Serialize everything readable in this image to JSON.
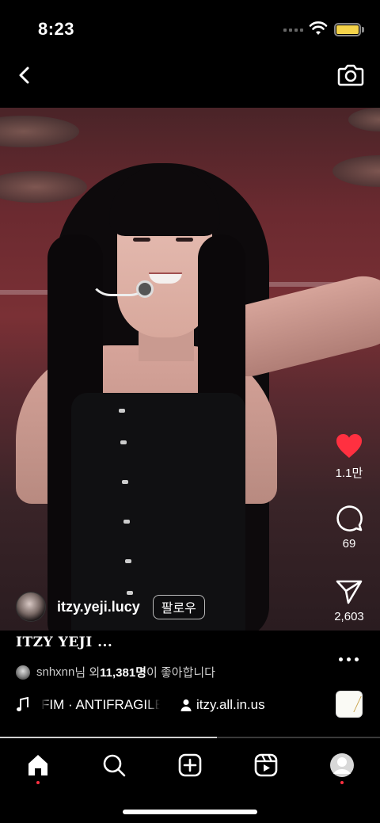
{
  "status_bar": {
    "time": "8:23",
    "battery_color": "#f5d34a"
  },
  "top_bar": {
    "back_icon": "chevron-left-icon",
    "camera_icon": "camera-icon"
  },
  "actions": {
    "like": {
      "icon": "heart-icon",
      "count": "1.1만",
      "liked": true,
      "color": "#ff3040"
    },
    "comment": {
      "icon": "comment-icon",
      "count": "69"
    },
    "share": {
      "icon": "send-icon",
      "count": "2,603"
    }
  },
  "author": {
    "username": "itzy.yeji.lucy",
    "follow_label": "팔로우"
  },
  "caption": {
    "text": "ITZY YEJI ..."
  },
  "likes": {
    "user": "snhxnn",
    "suffix_1": "님 외 ",
    "count": "11,381명",
    "suffix_2": "이 좋아합니다"
  },
  "audio": {
    "track": "FIM · ANTIFRAGILE",
    "audio_user": "itzy.all.in.us"
  },
  "playback": {
    "progress": 0.57
  },
  "bottom_nav": {
    "items": [
      "home-icon",
      "search-icon",
      "new-post-icon",
      "reels-icon",
      "profile-icon"
    ],
    "active": "home-icon"
  }
}
